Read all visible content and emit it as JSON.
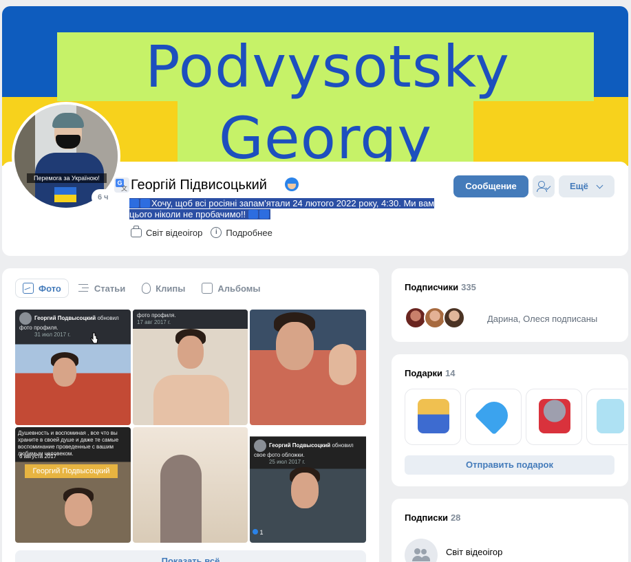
{
  "cover": {
    "line1": "Podvysotsky",
    "line2": "Georgy"
  },
  "avatar": {
    "caption": "Перемога за Україною!",
    "online": "6 ч"
  },
  "profile": {
    "name": "Георгій Підвисоцький",
    "status": "Хочу, щоб всі росіяні запам'ятали 24 лютого 2022 року, 4:30. Ми вам цього ніколи не пробачимо!!",
    "workplace": "Світ відеоігор",
    "more_info": "Подробнее"
  },
  "actions": {
    "message": "Сообщение",
    "more": "Ещё"
  },
  "tabs": [
    {
      "label": "Фото"
    },
    {
      "label": "Статьи"
    },
    {
      "label": "Клипы"
    },
    {
      "label": "Альбомы"
    }
  ],
  "photos": {
    "tile1": {
      "author": "Георгий Подвысоцкий",
      "action": "обновил фото профиля.",
      "date": "31 июл 2017 г."
    },
    "tile2": {
      "action": "фото профиля.",
      "date": "17 авг 2017 г."
    },
    "tile4": {
      "text": "Душевность и воспоминая , все что вы храните в своей душе и даже те самые воспоминание проведенные с вашим любимым человеком.",
      "date": "6 августа 2017",
      "banner": "Георгий Подвысоцкий"
    },
    "tile6": {
      "author": "Георгий Подвысоцкий",
      "action": "обновил свое фото обложки.",
      "date": "25 июл 2017 г.",
      "likes": "1"
    },
    "show_all": "Показать всё"
  },
  "subscribers": {
    "title": "Подписчики",
    "count": "335",
    "text": "Дарина, Олеся подписаны"
  },
  "gifts": {
    "title": "Подарки",
    "count": "14",
    "send": "Отправить подарок"
  },
  "following": {
    "title": "Подписки",
    "count": "28",
    "item": "Світ відеоігор"
  },
  "colors": {
    "accent": "#447bba",
    "cover_blue": "#0e5cbe",
    "cover_yellow": "#f7d21c",
    "cover_green": "#c6f268"
  }
}
